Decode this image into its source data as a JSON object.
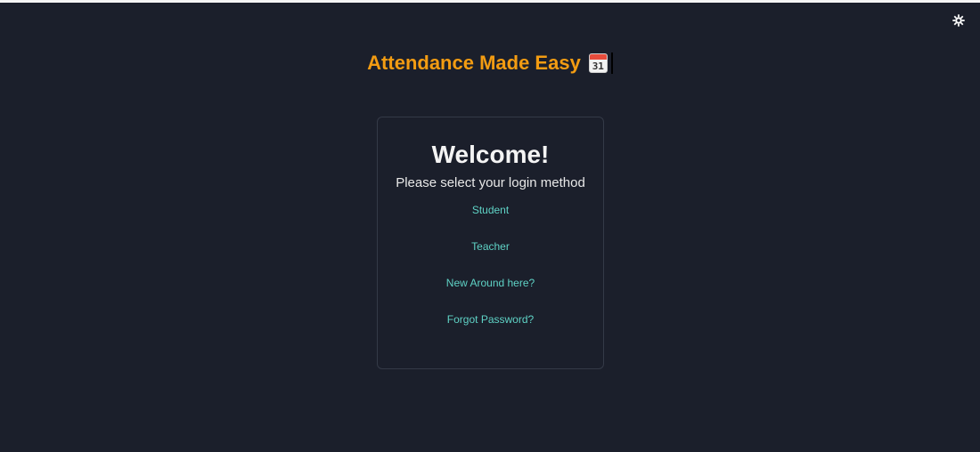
{
  "header": {
    "title": "Attendance Made Easy",
    "calendar_icon": "calendar-icon",
    "calendar_day": "31",
    "theme_toggle_icon": "gear-icon"
  },
  "card": {
    "title": "Welcome!",
    "subtitle": "Please select your login method",
    "links": [
      "Student",
      "Teacher",
      "New Around here?",
      "Forgot Password?"
    ]
  },
  "colors": {
    "background": "#1b1f2b",
    "heading": "#f39c12",
    "link": "#5fd3c6",
    "card_border": "#343a47"
  }
}
